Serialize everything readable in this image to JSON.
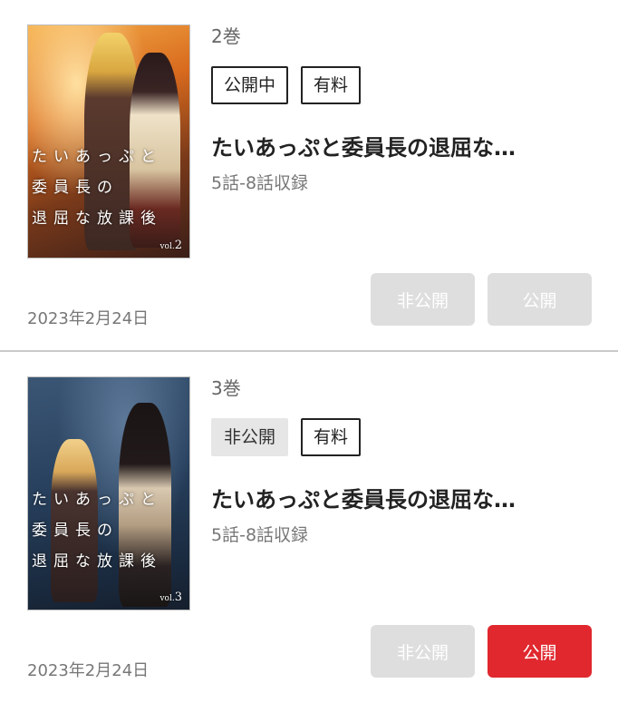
{
  "items": [
    {
      "volume": "2巻",
      "status_badge": "公開中",
      "price_badge": "有料",
      "title": "たいあっぷと委員長の退屈な…",
      "episodes": "5話-8話収録",
      "date": "2023年2月24日",
      "cover": {
        "title": "たいあっぷと\n委員長の\n退屈な放課後",
        "vol_prefix": "vol.",
        "vol_number": "2"
      },
      "actions": {
        "private_label": "非公開",
        "public_label": "公開",
        "public_active": false
      }
    },
    {
      "volume": "3巻",
      "status_badge": "非公開",
      "price_badge": "有料",
      "title": "たいあっぷと委員長の退屈な…",
      "episodes": "5話-8話収録",
      "date": "2023年2月24日",
      "cover": {
        "title": "たいあっぷと\n委員長の\n退屈な放課後",
        "vol_prefix": "vol.",
        "vol_number": "3"
      },
      "actions": {
        "private_label": "非公開",
        "public_label": "公開",
        "public_active": true
      }
    }
  ],
  "colors": {
    "accent": "#e0282e",
    "disabled": "#dedede",
    "divider": "#c9c9c9"
  }
}
